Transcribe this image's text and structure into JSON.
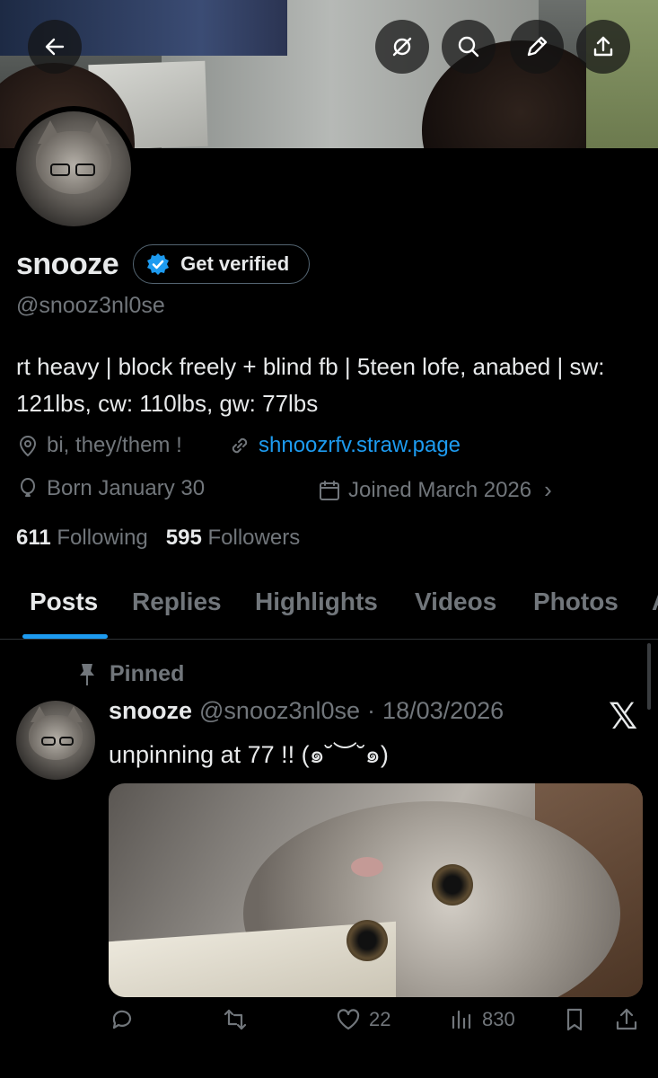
{
  "profile": {
    "display_name": "snooze",
    "verify_label": "Get verified",
    "handle": "@snooz3nl0se",
    "bio": "rt heavy | block freely + blind fb | 5teen lofe, anabed | sw: 121lbs, cw: 110lbs, gw: 77lbs",
    "location": "bi, they/them !",
    "website": "shnoozrfv.straw.page",
    "birthday": "Born January 30",
    "joined": "Joined March 2026",
    "following_count": "611",
    "following_label": "Following",
    "followers_count": "595",
    "followers_label": "Followers"
  },
  "tabs": [
    {
      "label": "Posts"
    },
    {
      "label": "Replies"
    },
    {
      "label": "Highlights"
    },
    {
      "label": "Videos"
    },
    {
      "label": "Photos"
    },
    {
      "label": "A"
    }
  ],
  "pinned_post": {
    "pinned_label": "Pinned",
    "author_name": "snooze",
    "author_handle": "@snooz3nl0se",
    "separator": "·",
    "date": "18/03/2026",
    "text": "unpinning at 77 !! (๑˘︶˘๑)",
    "source_logo": "𝕏",
    "likes": "22",
    "views": "830"
  },
  "colors": {
    "accent": "#1d9bf0",
    "muted": "#71767b",
    "text": "#e7e9ea",
    "background": "#000000"
  },
  "icons": {
    "back": "back-arrow-icon",
    "grok": "grok-icon",
    "search": "search-icon",
    "edit": "pencil-icon",
    "share": "share-icon"
  }
}
